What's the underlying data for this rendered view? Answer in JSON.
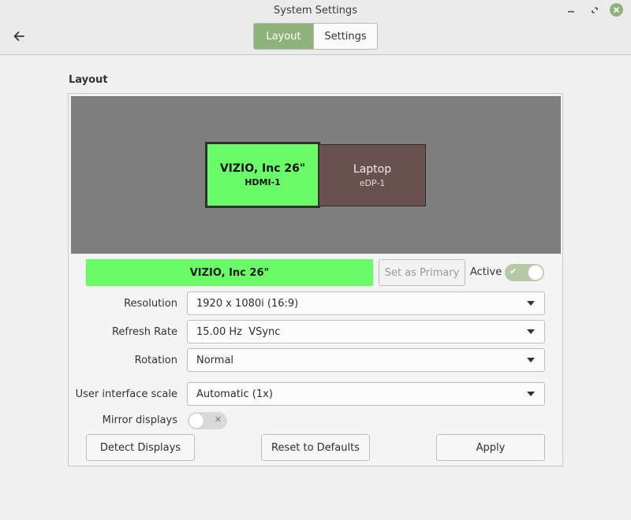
{
  "window": {
    "title": "System Settings"
  },
  "icons": {
    "back": "back-arrow-icon",
    "minimize": "minimize-icon",
    "maximize": "maximize-icon",
    "close": "close-icon"
  },
  "colors": {
    "accent": "#8fb27a",
    "selected_monitor": "#6afc68",
    "other_monitor": "#6b5050",
    "canvas": "#7f7f7f"
  },
  "tabs": [
    {
      "label": "Layout",
      "active": true
    },
    {
      "label": "Settings",
      "active": false
    }
  ],
  "layout": {
    "section_title": "Layout",
    "monitors": [
      {
        "name": "VIZIO, Inc 26\"",
        "connector": "HDMI-1",
        "selected": true
      },
      {
        "name": "Laptop",
        "connector": "eDP-1",
        "selected": false
      }
    ],
    "selected_monitor_label": "VIZIO, Inc 26\"",
    "set_primary_label": "Set as Primary",
    "active_label": "Active",
    "active_on": true
  },
  "settings": {
    "resolution": {
      "label": "Resolution",
      "value": "1920 x 1080i (16:9)"
    },
    "refresh_rate": {
      "label": "Refresh Rate",
      "value": "15.00 Hz  VSync"
    },
    "rotation": {
      "label": "Rotation",
      "value": "Normal"
    },
    "ui_scale": {
      "label": "User interface scale",
      "value": "Automatic (1x)"
    },
    "mirror": {
      "label": "Mirror displays",
      "on": false
    }
  },
  "buttons": {
    "detect": "Detect Displays",
    "reset": "Reset to Defaults",
    "apply": "Apply"
  }
}
